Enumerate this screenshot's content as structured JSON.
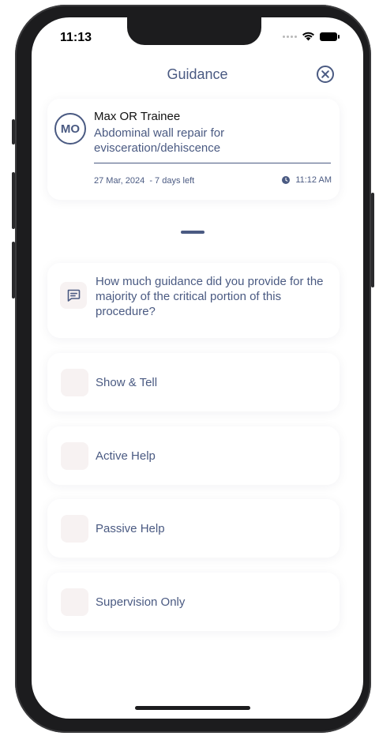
{
  "status": {
    "time": "11:13",
    "icons": [
      "signal-dots-icon",
      "wifi-icon",
      "battery-icon"
    ]
  },
  "header": {
    "title": "Guidance",
    "close_icon": "close-circle-icon"
  },
  "trainee": {
    "initials": "MO",
    "name": "Max OR Trainee",
    "procedure": "Abdominal wall repair for evisceration/dehiscence",
    "date_info": "27 Mar, 2024  - 7 days left",
    "time": "11:12 AM"
  },
  "question": {
    "icon": "chat-bubble-icon",
    "text": "How much guidance did you provide for the majority of the critical portion of this procedure?"
  },
  "options": [
    {
      "label": "Show & Tell"
    },
    {
      "label": "Active Help"
    },
    {
      "label": "Passive Help"
    },
    {
      "label": "Supervision Only"
    }
  ],
  "colors": {
    "primary": "#4a5a82",
    "option_box": "#f7f2f2",
    "frame": "#1c1c1e"
  }
}
